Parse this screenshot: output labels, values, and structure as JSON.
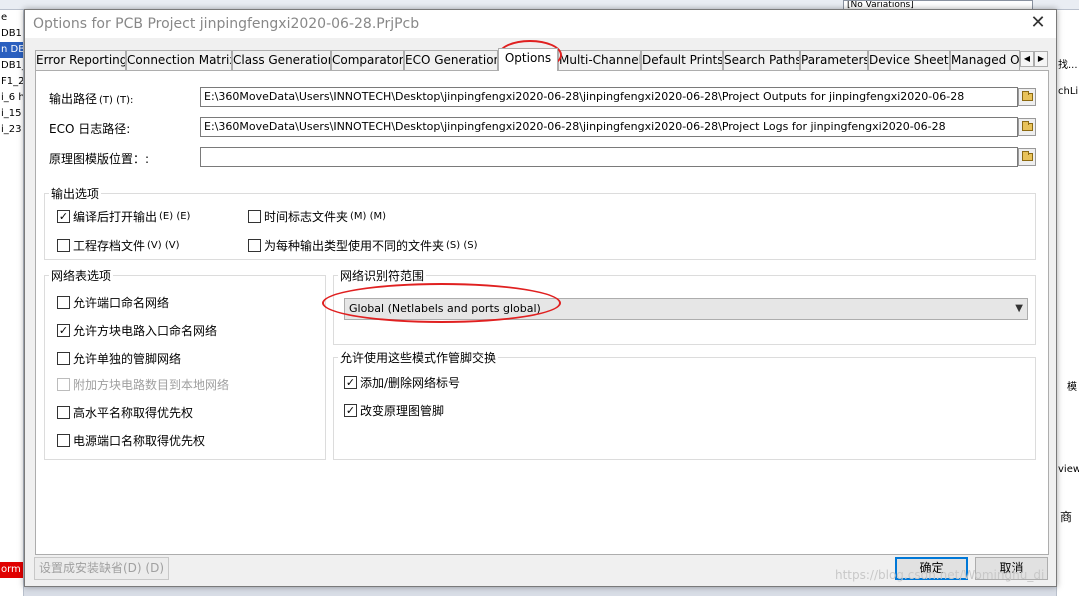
{
  "background": {
    "variations": "[No Variations]",
    "left_items": [
      "e",
      "DB1",
      "n DB",
      "DB1_",
      "F1_2",
      "i_6 h",
      "i_15",
      "i_23"
    ],
    "left_selected_index": 2,
    "left_red_item": "orm",
    "right_items": [
      "找...",
      "chLib",
      "模",
      "view",
      "商"
    ]
  },
  "dialog": {
    "title": "Options for PCB Project jinpingfengxi2020-06-28.PrjPcb",
    "close": "✕"
  },
  "tabs": [
    {
      "label": "Error Reporting"
    },
    {
      "label": "Connection Matrix"
    },
    {
      "label": "Class Generation"
    },
    {
      "label": "Comparator"
    },
    {
      "label": "ECO Generation"
    },
    {
      "label": "Options"
    },
    {
      "label": "Multi-Channel"
    },
    {
      "label": "Default Prints"
    },
    {
      "label": "Search Paths"
    },
    {
      "label": "Parameters"
    },
    {
      "label": "Device Sheets"
    },
    {
      "label": "Managed O"
    }
  ],
  "tab_scroll": {
    "left": "◀",
    "right": "▶"
  },
  "paths": {
    "output_label": "输出路径",
    "output_hotkey": "(T) (T):",
    "output_value": "E:\\360MoveData\\Users\\INNOTECH\\Desktop\\jinpingfengxi2020-06-28\\jinpingfengxi2020-06-28\\Project Outputs for jinpingfengxi2020-06-28",
    "eco_label": "ECO 日志路径:",
    "eco_value": "E:\\360MoveData\\Users\\INNOTECH\\Desktop\\jinpingfengxi2020-06-28\\jinpingfengxi2020-06-28\\Project Logs for jinpingfengxi2020-06-28",
    "template_label": "原理图模版位置：:",
    "template_value": ""
  },
  "output_options": {
    "title": "输出选项",
    "items": [
      {
        "label": "编译后打开输出",
        "hotkey": "(E) (E)",
        "checked": true
      },
      {
        "label": "时间标志文件夹",
        "hotkey": "(M) (M)",
        "checked": false
      },
      {
        "label": "工程存档文件",
        "hotkey": "(V) (V)",
        "checked": false
      },
      {
        "label": "为每种输出类型使用不同的文件夹",
        "hotkey": "(S) (S)",
        "checked": false
      }
    ]
  },
  "netlist_options": {
    "title": "网络表选项",
    "items": [
      {
        "label": "允许端口命名网络",
        "checked": false,
        "disabled": false
      },
      {
        "label": "允许方块电路入口命名网络",
        "checked": true,
        "disabled": false
      },
      {
        "label": "允许单独的管脚网络",
        "checked": false,
        "disabled": false
      },
      {
        "label": "附加方块电路数目到本地网络",
        "checked": false,
        "disabled": true
      },
      {
        "label": "高水平名称取得优先权",
        "checked": false,
        "disabled": false
      },
      {
        "label": "电源端口名称取得优先权",
        "checked": false,
        "disabled": false
      }
    ]
  },
  "net_identifier": {
    "title": "网络识别符范围",
    "value": "Global (Netlabels and ports global)",
    "arrow": "▼"
  },
  "pin_swap": {
    "title": "允许使用这些模式作管脚交换",
    "items": [
      {
        "label": "添加/删除网络标号",
        "checked": true
      },
      {
        "label": "改变原理图管脚",
        "checked": true
      }
    ]
  },
  "buttons": {
    "set_defaults": "设置成安装缺省(D) (D)",
    "ok": "确定",
    "cancel": "取消"
  },
  "watermark": "https://blog.csdn.net/Wominghu_di",
  "check_mark": "✓",
  "colors": {
    "annotation": "#e02020",
    "accent": "#0078d7"
  }
}
